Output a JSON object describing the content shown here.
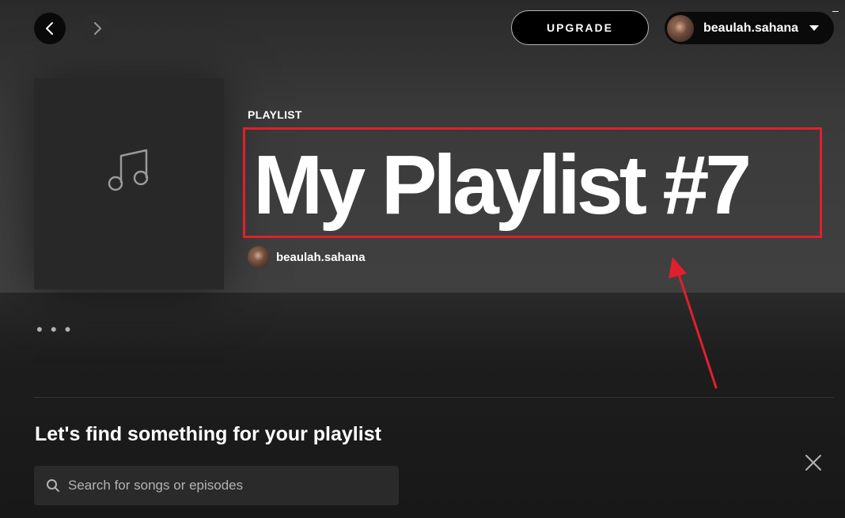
{
  "header": {
    "upgrade_label": "UPGRADE",
    "user_name": "beaulah.sahana",
    "window_minimize": "–"
  },
  "playlist": {
    "type_label": "PLAYLIST",
    "title": "My Playlist #7",
    "owner_name": "beaulah.sahana"
  },
  "actions": {
    "more_label": "• • •"
  },
  "find": {
    "heading": "Let's find something for your playlist",
    "search_placeholder": "Search for songs or episodes",
    "search_value": ""
  },
  "icons": {
    "back": "chevron-left-icon",
    "forward": "chevron-right-icon",
    "cover": "music-note-icon",
    "search": "search-icon",
    "close": "close-icon",
    "dropdown": "caret-down-icon"
  },
  "colors": {
    "annotation": "#e0202c",
    "background": "#121212",
    "text": "#ffffff",
    "muted_text": "#b3b3b3"
  }
}
